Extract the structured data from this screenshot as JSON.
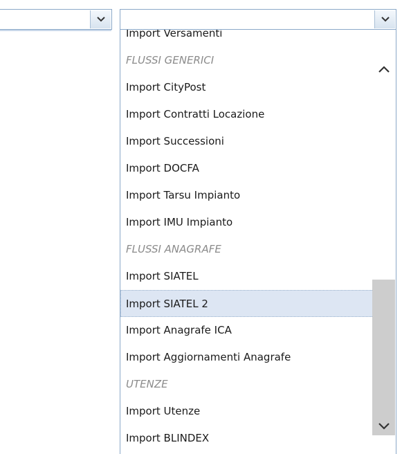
{
  "left_combo": {
    "value": ""
  },
  "right_combo": {
    "value": ""
  },
  "dropdown": {
    "items": [
      {
        "label": "Import Versamenti",
        "kind": "option"
      },
      {
        "label": "FLUSSI GENERICI",
        "kind": "group"
      },
      {
        "label": "Import CityPost",
        "kind": "option"
      },
      {
        "label": "Import Contratti Locazione",
        "kind": "option"
      },
      {
        "label": "Import Successioni",
        "kind": "option"
      },
      {
        "label": "Import DOCFA",
        "kind": "option"
      },
      {
        "label": "Import Tarsu Impianto",
        "kind": "option"
      },
      {
        "label": "Import IMU Impianto",
        "kind": "option"
      },
      {
        "label": "FLUSSI ANAGRAFE",
        "kind": "group"
      },
      {
        "label": "Import SIATEL",
        "kind": "option"
      },
      {
        "label": "Import SIATEL 2",
        "kind": "option",
        "highlighted": true
      },
      {
        "label": "Import Anagrafe ICA",
        "kind": "option"
      },
      {
        "label": "Import Aggiornamenti Anagrafe",
        "kind": "option"
      },
      {
        "label": "UTENZE",
        "kind": "group"
      },
      {
        "label": "Import Utenze",
        "kind": "option"
      },
      {
        "label": "Import BLINDEX",
        "kind": "option"
      }
    ]
  },
  "icons": {
    "combo_trigger": "chevron-down-icon",
    "scroll_up": "chevron-up-icon",
    "scroll_down": "chevron-down-icon"
  },
  "colors": {
    "border": "#8aa8c8",
    "highlight": "#dde6f3",
    "group_text": "#8b8b8b",
    "scroll_thumb": "#cdcdcd"
  }
}
